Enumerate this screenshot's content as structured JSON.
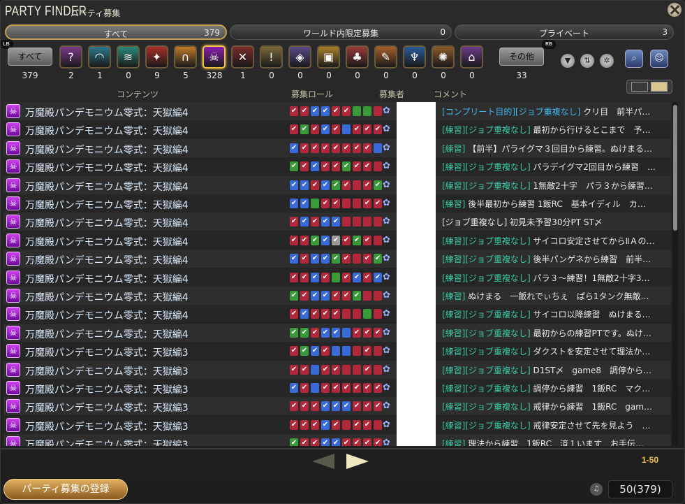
{
  "window": {
    "title": "PARTY FINDER",
    "subtitle": "パーティ募集"
  },
  "badges": {
    "lb": "LB",
    "rb": "RB"
  },
  "tabs": [
    {
      "label": "すべて",
      "count": "379",
      "active": true
    },
    {
      "label": "ワールド内限定募集",
      "count": "0",
      "active": false
    },
    {
      "label": "プライベート",
      "count": "3",
      "active": false
    }
  ],
  "categories": {
    "all": {
      "label": "すべて",
      "count": "379"
    },
    "items": [
      {
        "icon": "question-icon",
        "glyph": "?",
        "color": "#7a3a8a",
        "count": "2"
      },
      {
        "icon": "dungeon-icon",
        "glyph": "◠",
        "color": "#2a7a8a",
        "count": "1"
      },
      {
        "icon": "guildhest-icon",
        "glyph": "≋",
        "color": "#2a8a7a",
        "count": "0"
      },
      {
        "icon": "trial-icon",
        "glyph": "✦",
        "color": "#a8302a",
        "count": "9"
      },
      {
        "icon": "raid-icon",
        "glyph": "∩",
        "color": "#c07a2a",
        "count": "5"
      },
      {
        "icon": "high-end-raid-icon",
        "glyph": "☠",
        "color": "#8a20b0",
        "count": "328",
        "selected": true
      },
      {
        "icon": "pvp-icon",
        "glyph": "✕",
        "color": "#7a2a2a",
        "count": "1"
      },
      {
        "icon": "quest-icon",
        "glyph": "!",
        "color": "#7a6a3a",
        "count": "0"
      },
      {
        "icon": "fates-icon",
        "glyph": "◈",
        "color": "#5a4a8a",
        "count": "0"
      },
      {
        "icon": "treasure-hunt-icon",
        "glyph": "▣",
        "color": "#a8802a",
        "count": "0"
      },
      {
        "icon": "gathering-icon",
        "glyph": "♣",
        "color": "#9a3a3a",
        "count": "0"
      },
      {
        "icon": "crafting-icon",
        "glyph": "✎",
        "color": "#a8602a",
        "count": "0"
      },
      {
        "icon": "deep-dungeon-icon",
        "glyph": "♆",
        "color": "#2a5a9a",
        "count": "0"
      },
      {
        "icon": "field-operation-icon",
        "glyph": "✺",
        "color": "#8a5a2a",
        "count": "0"
      },
      {
        "icon": "v-and-c-dungeon-icon",
        "glyph": "⌂",
        "color": "#6a3a8a",
        "count": "0"
      }
    ],
    "other": {
      "label": "その他",
      "count": "33"
    }
  },
  "tools": [
    {
      "icon": "filter-icon",
      "glyph": "▼"
    },
    {
      "icon": "sort-icon",
      "glyph": "⇅"
    },
    {
      "icon": "settings-icon",
      "glyph": "✲"
    },
    {
      "icon": "search-icon",
      "glyph": "⌕"
    },
    {
      "icon": "party-icon",
      "glyph": "☺"
    }
  ],
  "columns": {
    "content": "コンテンツ",
    "roles": "募集ロール",
    "recruiter": "募集者",
    "comment": "コメント"
  },
  "rows": [
    {
      "duty": "万魔殿パンデモニウム零式：天獄編4",
      "roles": [
        "D",
        "D",
        "T",
        "T",
        "D",
        "D",
        "He",
        "He",
        "De"
      ],
      "tag": "[コンプリート目的][ジョブ重複なし]",
      "tagstyle": "b",
      "comment": " クリ目　前半パ…"
    },
    {
      "duty": "万魔殿パンデモニウム零式：天獄編4",
      "roles": [
        "D",
        "H",
        "D",
        "T",
        "D",
        "Te",
        "D",
        "D",
        "D"
      ],
      "tag": "[練習][ジョブ重複なし]",
      "tagstyle": "g",
      "comment": " 最初から行けるとこまで　予…"
    },
    {
      "duty": "万魔殿パンデモニウム零式：天獄編4",
      "roles": [
        "T",
        "D",
        "D",
        "D",
        "D",
        "D",
        "D",
        "D",
        "Te"
      ],
      "tag": "[練習]",
      "tagstyle": "g",
      "comment": " 【前半】パライグマ３回目から練習。ぬけまる…"
    },
    {
      "duty": "万魔殿パンデモニウム零式：天獄編4",
      "roles": [
        "H",
        "D",
        "T",
        "D",
        "D",
        "H",
        "D",
        "D",
        "De"
      ],
      "tag": "[練習][ジョブ重複なし]",
      "tagstyle": "g",
      "comment": " パラデイグマ2回目から練習　…"
    },
    {
      "duty": "万魔殿パンデモニウム零式：天獄編4",
      "roles": [
        "T",
        "T",
        "D",
        "T",
        "H",
        "D",
        "De",
        "D",
        "H"
      ],
      "tag": "[練習][ジョブ重複なし]",
      "tagstyle": "g",
      "comment": " 1無敵2十字　パラ３から練習…"
    },
    {
      "duty": "万魔殿パンデモニウム零式：天獄編4",
      "roles": [
        "T",
        "T",
        "He",
        "D",
        "D",
        "De",
        "De",
        "D",
        "D"
      ],
      "tag": "[練習]",
      "tagstyle": "g",
      "comment": " 後半最初から練習 1飯RC　基本イディル　カ…"
    },
    {
      "duty": "万魔殿パンデモニウム零式：天獄編4",
      "roles": [
        "D",
        "T",
        "D",
        "T",
        "T",
        "De",
        "De",
        "De",
        "De"
      ],
      "tag": "",
      "tagstyle": "",
      "comment": "[ジョブ重複なし] 初見未予習30分PT ST〆"
    },
    {
      "duty": "万魔殿パンデモニウム零式：天獄編4",
      "roles": [
        "D",
        "D",
        "H",
        "T",
        "A",
        "D",
        "H",
        "D",
        "De"
      ],
      "tag": "[練習][ジョブ重複なし]",
      "tagstyle": "g",
      "comment": " サイコロ安定させてからⅡＡの…"
    },
    {
      "duty": "万魔殿パンデモニウム零式：天獄編4",
      "roles": [
        "T",
        "D",
        "T",
        "T",
        "H",
        "D",
        "De",
        "D",
        "H"
      ],
      "tag": "[練習][ジョブ重複なし]",
      "tagstyle": "g",
      "comment": " 後半パンゲネから練習　前半…"
    },
    {
      "duty": "万魔殿パンデモニウム零式：天獄編4",
      "roles": [
        "D",
        "D",
        "T",
        "D",
        "He",
        "D",
        "T",
        "D",
        "T"
      ],
      "tag": "[練習][ジョブ重複なし]",
      "tagstyle": "g",
      "comment": " パラ３～練習！1無敵2十字3…"
    },
    {
      "duty": "万魔殿パンデモニウム零式：天獄編4",
      "roles": [
        "H",
        "D",
        "T",
        "T",
        "D",
        "D",
        "H",
        "De",
        "De"
      ],
      "tag": "[練習]",
      "tagstyle": "g",
      "comment": " ぬけまる　一飯れでぃちぇ　ぱら1タンク無敵…"
    },
    {
      "duty": "万魔殿パンデモニウム零式：天獄編4",
      "roles": [
        "D",
        "T",
        "D",
        "D",
        "D",
        "De",
        "De",
        "He",
        "De"
      ],
      "tag": "[練習][ジョブ重複なし]",
      "tagstyle": "g",
      "comment": " サイコロ以降練習　ぬけまる…"
    },
    {
      "duty": "万魔殿パンデモニウム零式：天獄編4",
      "roles": [
        "H",
        "H",
        "D",
        "T",
        "T",
        "Te",
        "D",
        "D",
        "D"
      ],
      "tag": "[練習][ジョブ重複なし]",
      "tagstyle": "g",
      "comment": " 最初からの練習PTです。ぬけ…"
    },
    {
      "duty": "万魔殿パンデモニウム零式：天獄編3",
      "roles": [
        "D",
        "H",
        "T",
        "D",
        "Te",
        "Te",
        "De",
        "D",
        "De"
      ],
      "tag": "[練習][ジョブ重複なし]",
      "tagstyle": "g",
      "comment": " ダクストを安定させて理法か…"
    },
    {
      "duty": "万魔殿パンデモニウム零式：天獄編3",
      "roles": [
        "D",
        "D",
        "Te",
        "D",
        "D",
        "De",
        "De",
        "D",
        "De"
      ],
      "tag": "[練習][ジョブ重複なし]",
      "tagstyle": "g",
      "comment": " D1ST〆　game8　調停から…"
    },
    {
      "duty": "万魔殿パンデモニウム零式：天獄編3",
      "roles": [
        "T",
        "D",
        "Te",
        "D",
        "D",
        "D",
        "D",
        "D",
        "D"
      ],
      "tag": "[練習][ジョブ重複なし]",
      "tagstyle": "g",
      "comment": " 調停から練習　1飯RC　マク…"
    },
    {
      "duty": "万魔殿パンデモニウム零式：天獄編3",
      "roles": [
        "D",
        "D",
        "D",
        "T",
        "T",
        "T",
        "D",
        "D",
        "D"
      ],
      "tag": "[練習][ジョブ重複なし]",
      "tagstyle": "g",
      "comment": " 戒律から練習　1飯RC　gam…"
    },
    {
      "duty": "万魔殿パンデモニウム零式：天獄編3",
      "roles": [
        "D",
        "D",
        "D",
        "T",
        "D",
        "De",
        "D",
        "D",
        "De"
      ],
      "tag": "[練習][ジョブ重複なし]",
      "tagstyle": "g",
      "comment": " 戒律安定させて先を見よう　…"
    },
    {
      "duty": "万魔殿パンデモニウム零式：天獄編3",
      "roles": [
        "H",
        "D",
        "D",
        "T",
        "T",
        "D",
        "D",
        "D",
        "D"
      ],
      "tag": "[練習]",
      "tagstyle": "g",
      "comment": " 理法から練習　1飯RC　済１います　お手伝…"
    }
  ],
  "pagination": {
    "range": "1-50"
  },
  "footer": {
    "register_label": "パーティ募集の登録",
    "count_display": "50(379)"
  },
  "colors": {
    "accent": "#c8a050",
    "tank": "#3a6ad8",
    "healer": "#3a9a3a",
    "dps": "#b0283a",
    "tag_green": "#3ac8a8",
    "tag_blue": "#40b8f0"
  }
}
